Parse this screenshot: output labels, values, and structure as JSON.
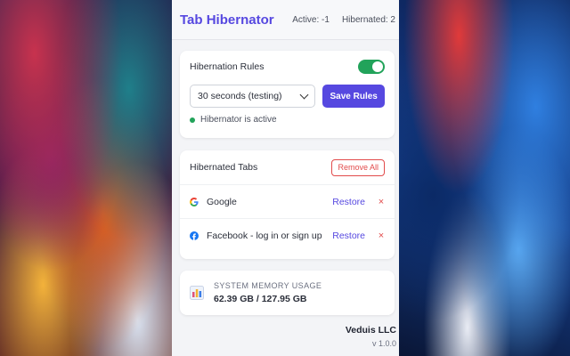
{
  "app": {
    "title": "Tab Hibernator",
    "active_label": "Active: -1",
    "hibernated_label": "Hibernated: 2"
  },
  "rules": {
    "title": "Hibernation Rules",
    "toggle_on": true,
    "select_value": "30 seconds (testing)",
    "save_label": "Save Rules",
    "status_text": "Hibernator is active"
  },
  "hibernated": {
    "title": "Hibernated Tabs",
    "remove_all_label": "Remove All",
    "tabs": [
      {
        "title": "Google",
        "icon": "google-icon",
        "restore_label": "Restore",
        "close_label": "×"
      },
      {
        "title": "Facebook - log in or sign up",
        "icon": "facebook-icon",
        "restore_label": "Restore",
        "close_label": "×"
      }
    ]
  },
  "memory": {
    "label": "SYSTEM MEMORY USAGE",
    "value": "62.39 GB / 127.95 GB",
    "icon": "bar-chart-icon"
  },
  "footer": {
    "company": "Veduis LLC",
    "version": "v 1.0.0"
  },
  "colors": {
    "accent": "#5648e0",
    "success": "#22a35a",
    "danger": "#e24b4b"
  }
}
